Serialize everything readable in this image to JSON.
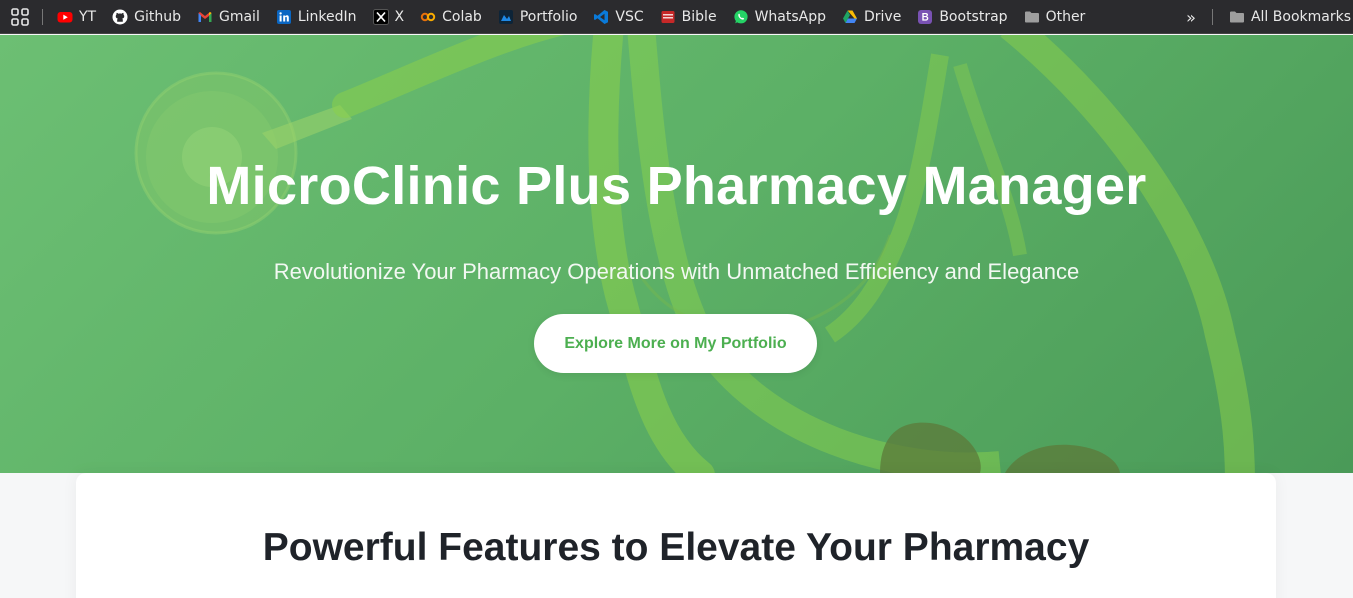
{
  "bookmarks": {
    "items": [
      {
        "label": "YT",
        "icon": "youtube-icon",
        "color": "#ff0000"
      },
      {
        "label": "Github",
        "icon": "github-icon",
        "color": "#ffffff"
      },
      {
        "label": "Gmail",
        "icon": "gmail-icon",
        "color": "#ea4335"
      },
      {
        "label": "LinkedIn",
        "icon": "linkedin-icon",
        "color": "#0a66c2"
      },
      {
        "label": "X",
        "icon": "x-icon",
        "color": "#ffffff"
      },
      {
        "label": "Colab",
        "icon": "colab-icon",
        "color": "#f9ab00"
      },
      {
        "label": "Portfolio",
        "icon": "portfolio-icon",
        "color": "#1e88e5"
      },
      {
        "label": "VSC",
        "icon": "vscode-icon",
        "color": "#0a7ad9"
      },
      {
        "label": "Bible",
        "icon": "bible-icon",
        "color": "#c62828"
      },
      {
        "label": "WhatsApp",
        "icon": "whatsapp-icon",
        "color": "#25d366"
      },
      {
        "label": "Drive",
        "icon": "drive-icon",
        "color": "#1fa463"
      },
      {
        "label": "Bootstrap",
        "icon": "bootstrap-icon",
        "color": "#7952b3"
      },
      {
        "label": "Other",
        "icon": "folder-icon",
        "color": "#9e9e9e"
      }
    ],
    "all_bookmarks": "All Bookmarks"
  },
  "hero": {
    "title": "MicroClinic Plus Pharmacy Manager",
    "subtitle": "Revolutionize Your Pharmacy Operations with Unmatched Efficiency and Elegance",
    "cta_label": "Explore More on My Portfolio",
    "accent_color": "#4caf50"
  },
  "features": {
    "title": "Powerful Features to Elevate Your Pharmacy"
  }
}
